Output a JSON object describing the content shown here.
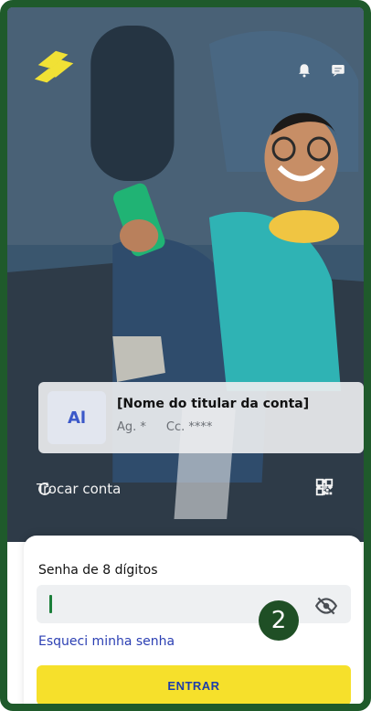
{
  "header": {
    "logo_name": "bb-logo",
    "notifications_icon": "bell-icon",
    "messages_icon": "chat-icon"
  },
  "account": {
    "avatar_initials": "Al",
    "holder_name": "[Nome do titular da conta]",
    "agency_label": "Ag. *",
    "account_label": "Cc. ****"
  },
  "actions": {
    "switch_account": "Trocar conta",
    "pix_icon": "pix-icon",
    "qr_icon": "qr-code-icon"
  },
  "login": {
    "password_label": "Senha de 8 dígitos",
    "password_value": "",
    "visibility_icon": "eye-off-icon",
    "forgot_link": "Esqueci minha senha",
    "enter_button": "ENTRAR"
  },
  "badge": {
    "value": "2"
  },
  "colors": {
    "frame": "#1f5a2b",
    "accent_yellow": "#f6e02b",
    "link_blue": "#2b3fb3",
    "badge_green": "#1f4f25"
  }
}
